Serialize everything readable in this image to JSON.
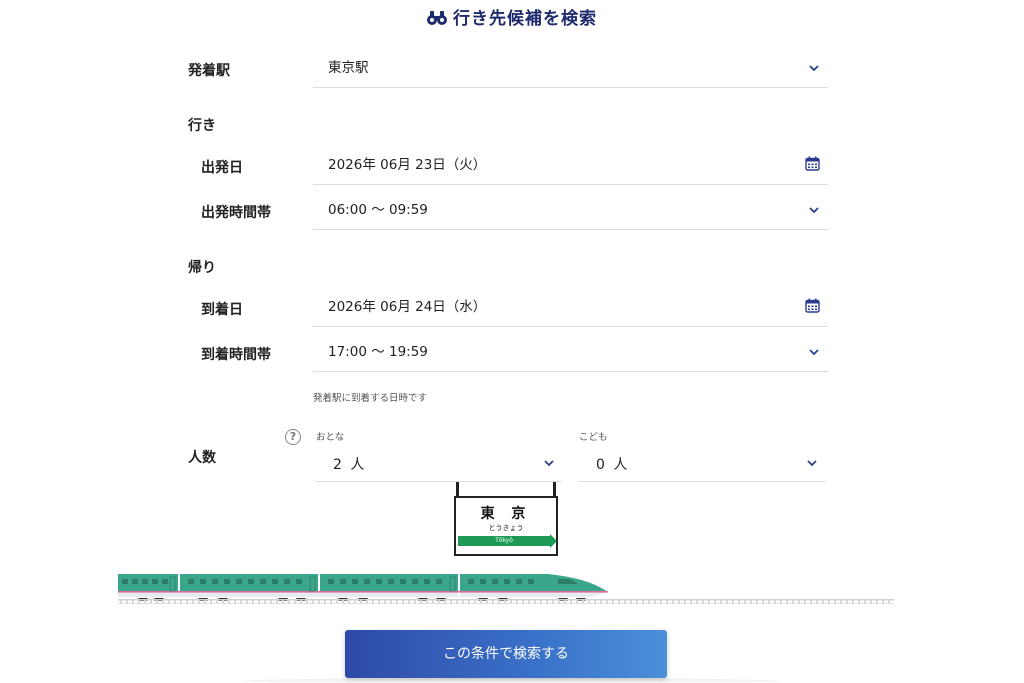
{
  "header": {
    "title": "行き先候補を検索",
    "icon": "binoculars-icon"
  },
  "departure_station": {
    "label": "発着駅",
    "value": "東京駅"
  },
  "outbound": {
    "section_label": "行き",
    "date_label": "出発日",
    "date_value": "2026年 06月 23日（火）",
    "time_label": "出発時間帯",
    "time_value": "06:00 〜 09:59"
  },
  "return": {
    "section_label": "帰り",
    "date_label": "到着日",
    "date_value": "2026年 06月 24日（水）",
    "time_label": "到着時間帯",
    "time_value": "17:00 〜 19:59",
    "note": "発着駅に到着する日時です"
  },
  "passengers": {
    "label": "人数",
    "help_icon": "?",
    "adult_label": "おとな",
    "adult_value": "2 人",
    "child_label": "こども",
    "child_value": "0 人"
  },
  "station_sign": {
    "name": "東 京",
    "kana": "とうきょう",
    "romaji": "Tōkyō"
  },
  "colors": {
    "accent": "#1e2a6e",
    "train_green": "#3aa68a",
    "sign_green": "#1d9a55",
    "button_start": "#2f4aa8",
    "button_end": "#4a90d8"
  },
  "search_button": {
    "label": "この条件で検索する"
  }
}
